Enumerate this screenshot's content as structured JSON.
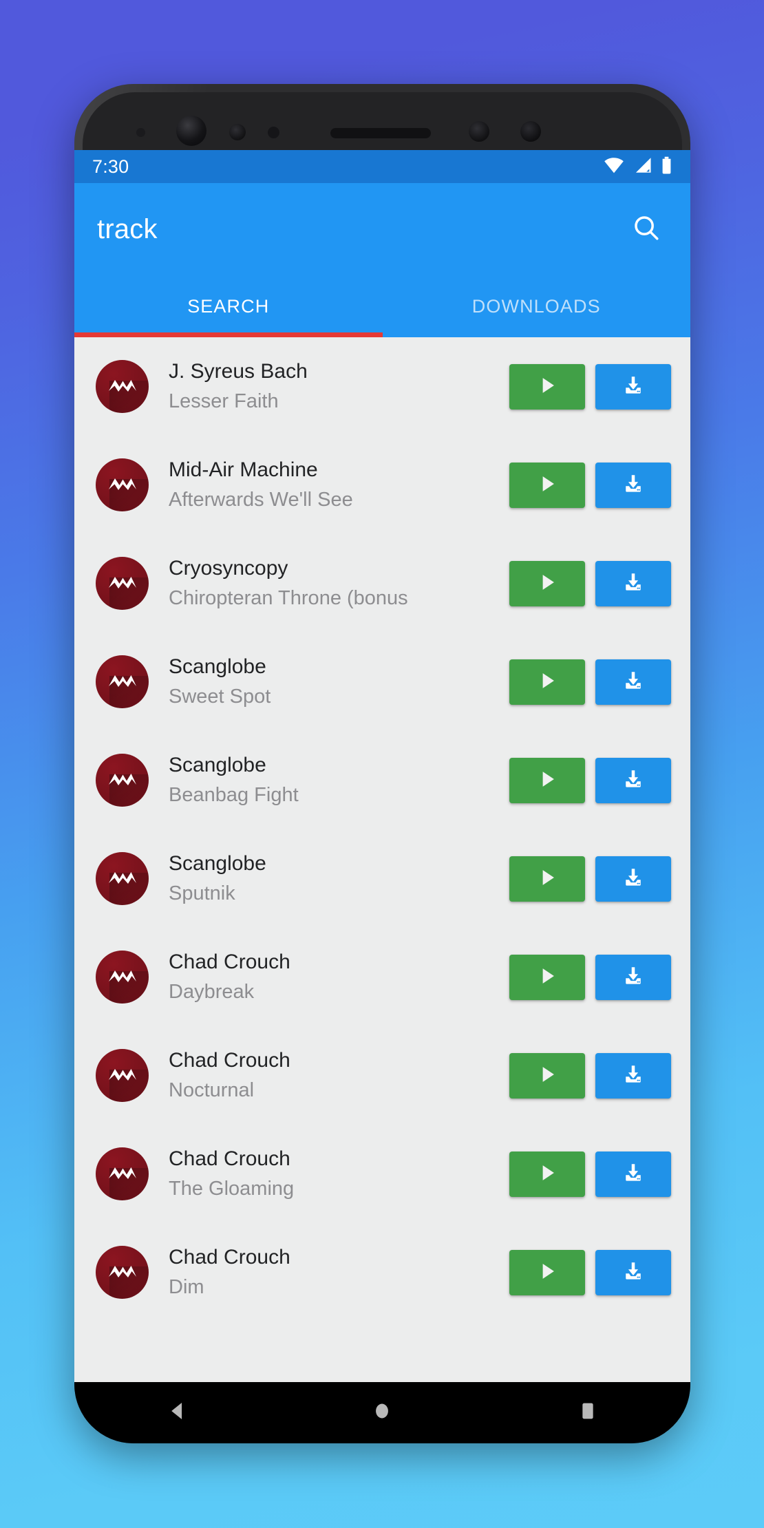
{
  "background": {
    "gradient_from": "#5159dc",
    "gradient_to": "#5ccbf8"
  },
  "device": {
    "name": "android-phone",
    "sensors": [
      "front-camera",
      "proximity-sensor",
      "light-sensor",
      "earpiece-speaker",
      "iris-scanner",
      "led-indicator"
    ]
  },
  "status_bar": {
    "time": "7:30",
    "background": "#1877d2",
    "icons": [
      "wifi-icon",
      "cellular-signal-icon",
      "battery-icon"
    ]
  },
  "app_bar": {
    "title": "track",
    "background": "#2196f3",
    "search_icon": "search-icon"
  },
  "tabs": {
    "indicator_color": "#e53935",
    "active_index": 0,
    "items": [
      {
        "label": "SEARCH",
        "active": true
      },
      {
        "label": "DOWNLOADS",
        "active": false
      }
    ]
  },
  "list": {
    "background": "#eceded",
    "avatar_color": "#7d131d",
    "play_button": {
      "label": "play-icon",
      "color": "#41a047"
    },
    "download_button": {
      "label": "download-icon",
      "color": "#2092e8"
    },
    "rows": [
      {
        "artist": "J. Syreus Bach",
        "title": "Lesser Faith"
      },
      {
        "artist": "Mid-Air Machine",
        "title": "Afterwards We'll See"
      },
      {
        "artist": "Cryosyncopy",
        "title": "Chiropteran Throne (bonus"
      },
      {
        "artist": "Scanglobe",
        "title": "Sweet Spot"
      },
      {
        "artist": "Scanglobe",
        "title": "Beanbag Fight"
      },
      {
        "artist": "Scanglobe",
        "title": "Sputnik"
      },
      {
        "artist": "Chad Crouch",
        "title": "Daybreak"
      },
      {
        "artist": "Chad Crouch",
        "title": "Nocturnal"
      },
      {
        "artist": "Chad Crouch",
        "title": "The Gloaming"
      },
      {
        "artist": "Chad Crouch",
        "title": "Dim"
      }
    ]
  },
  "nav_bar": {
    "background": "#000000",
    "buttons": [
      "back-icon",
      "home-icon",
      "recents-icon"
    ]
  }
}
